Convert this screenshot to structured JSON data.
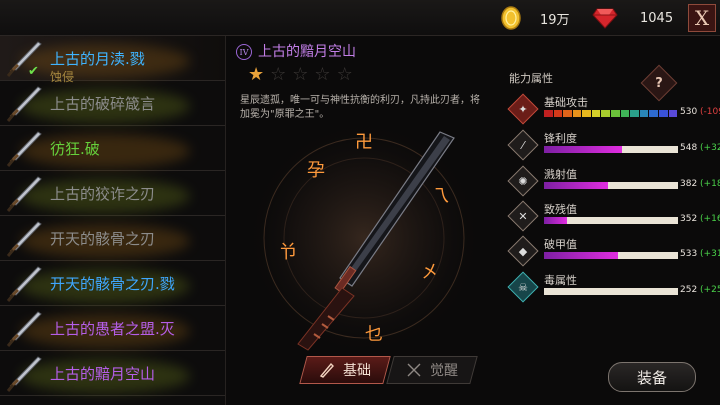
{
  "resources": {
    "gold": {
      "value": "19万",
      "icon": "gold-coin-icon",
      "color": "#f2c12e"
    },
    "gems": {
      "value": "1045",
      "icon": "red-gem-icon",
      "color": "#d5262c"
    },
    "close_label": "X"
  },
  "weapon_list": [
    {
      "name": "上古的月渎.戮",
      "color": "#3fb4ff",
      "selected": true,
      "equipped": true,
      "sub": "蚀侵"
    },
    {
      "name": "上古的破碎箴言",
      "color": "#8c8c8c"
    },
    {
      "name": "彷狂.破",
      "color": "#66d13c"
    },
    {
      "name": "上古的狡诈之刃",
      "color": "#8c8c8c"
    },
    {
      "name": "开天的骸骨之刃",
      "color": "#8c8c8c"
    },
    {
      "name": "开天的骸骨之刃.戮",
      "color": "#3fa7ff"
    },
    {
      "name": "上古的愚者之盟.灭",
      "color": "#b55ee8"
    },
    {
      "name": "上古的黯月空山",
      "color": "#b55ee8"
    }
  ],
  "weapon": {
    "tier": "IV",
    "title": "上古的黯月空山",
    "stars_filled": 1,
    "stars_total": 5,
    "description": "星辰遗孤，唯一可与神性抗衡的利刃，凡持此刃者，将加冕为\"原罪之王\"。",
    "runes": [
      "卍",
      "孕",
      "乁",
      "兯",
      "㐅",
      "乜"
    ]
  },
  "tabs": {
    "basic": "基础",
    "awaken": "觉醒"
  },
  "attributes": {
    "title": "能力属性",
    "help_label": "?",
    "rows": [
      {
        "label": "基础攻击",
        "value": "530",
        "delta": "(-109)",
        "negative": true,
        "segmented": true,
        "fill": 0.84,
        "icon": "attack-emblem-icon"
      },
      {
        "label": "锋利度",
        "value": "548",
        "delta": "(+320)",
        "fill": 0.58,
        "icon": "sharpness-icon"
      },
      {
        "label": "溅射值",
        "value": "382",
        "delta": "(+182)",
        "fill": 0.48,
        "icon": "splash-icon"
      },
      {
        "label": "致残值",
        "value": "352",
        "delta": "(+160)",
        "fill": 0.17,
        "icon": "cripple-icon"
      },
      {
        "label": "破甲值",
        "value": "533",
        "delta": "(+319)",
        "fill": 0.55,
        "icon": "armor-break-icon"
      },
      {
        "label": "毒属性",
        "value": "252",
        "delta": "(+252)",
        "fill": 0.0,
        "icon": "poison-skull-icon"
      }
    ]
  },
  "equip_label": "装备"
}
